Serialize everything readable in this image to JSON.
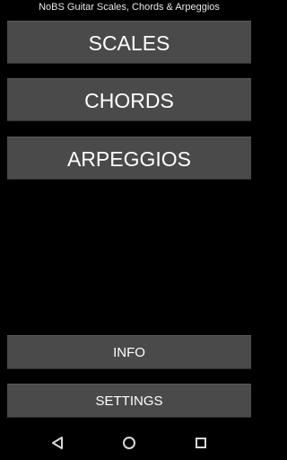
{
  "app_title": "NoBS Guitar Scales, Chords & Arpeggios",
  "menu": {
    "scales_label": "SCALES",
    "chords_label": "CHORDS",
    "arpeggios_label": "ARPEGGIOS"
  },
  "footer": {
    "info_label": "INFO",
    "settings_label": "SETTINGS"
  },
  "nav": {
    "back_icon": "back-triangle-icon",
    "home_icon": "home-circle-icon",
    "recents_icon": "recents-square-icon"
  },
  "colors": {
    "background": "#000000",
    "button": "#4a4a4a",
    "text": "#ffffff"
  }
}
